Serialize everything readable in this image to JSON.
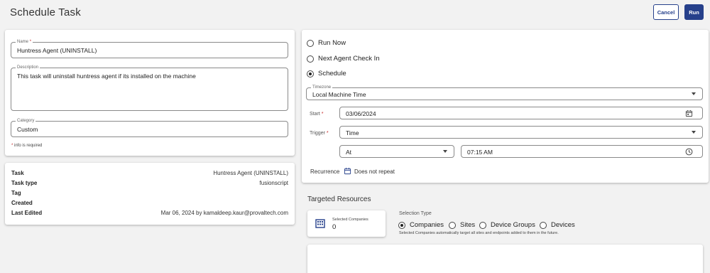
{
  "header": {
    "title": "Schedule Task",
    "cancel_label": "Cancel",
    "run_label": "Run"
  },
  "form": {
    "name": {
      "label": "Name",
      "value": "Huntress Agent (UNINSTALL)"
    },
    "description": {
      "label": "Description",
      "value": "This task will uninstall huntress agent if its installed on the machine"
    },
    "category": {
      "label": "Category",
      "value": "Custom"
    },
    "required_note": "info is required"
  },
  "details": [
    {
      "key": "Task",
      "value": "Huntress Agent (UNINSTALL)"
    },
    {
      "key": "Task type",
      "value": "fusionscript"
    },
    {
      "key": "Tag",
      "value": ""
    },
    {
      "key": "Created",
      "value": ""
    },
    {
      "key": "Last Edited",
      "value": "Mar 06, 2024 by kamaldeep.kaur@provaltech.com"
    }
  ],
  "schedule": {
    "options": [
      {
        "label": "Run Now",
        "selected": false
      },
      {
        "label": "Next Agent Check In",
        "selected": false
      },
      {
        "label": "Schedule",
        "selected": true
      }
    ],
    "timezone": {
      "label": "Timezone",
      "value": "Local Machine Time"
    },
    "start": {
      "label": "Start",
      "value": "03/06/2024"
    },
    "trigger": {
      "label": "Trigger",
      "value": "Time"
    },
    "at": {
      "value": "At"
    },
    "time": {
      "value": "07:15 AM"
    },
    "recurrence": {
      "label": "Recurrence",
      "value": "Does not repeat"
    }
  },
  "targeted": {
    "title": "Targeted Resources",
    "selected_label": "Selected Companies",
    "selected_count": "0",
    "selection_type_label": "Selection Type",
    "options": [
      {
        "label": "Companies",
        "selected": true
      },
      {
        "label": "Sites",
        "selected": false
      },
      {
        "label": "Device Groups",
        "selected": false
      },
      {
        "label": "Devices",
        "selected": false
      }
    ],
    "note": "Selected Companies automatically target all sites and endpoints added to them in the future."
  },
  "colors": {
    "primary": "#26408b",
    "required": "#c62828",
    "background": "#f2f2f2"
  }
}
